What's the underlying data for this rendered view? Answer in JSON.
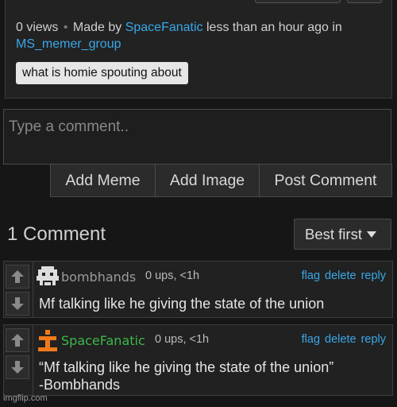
{
  "meme": {
    "views": "0 views",
    "separator": "•",
    "made_by": "Made by",
    "author": "SpaceFanatic",
    "time_in": "less than an hour ago in",
    "group": "MS_memer_group",
    "tag": "what is homie spouting about"
  },
  "composer": {
    "placeholder": "Type a comment..",
    "buttons": [
      "Add Meme",
      "Add Image",
      "Post Comment"
    ]
  },
  "comments_header": {
    "count_label": "1 Comment",
    "sort_label": "Best first"
  },
  "comments": [
    {
      "username": "bombhands",
      "username_color": "#9a9a9a",
      "meta": "0 ups, <1h",
      "actions": [
        "flag",
        "delete",
        "reply"
      ],
      "text_lines": [
        "Mf talking like he giving the state of the union"
      ],
      "avatar_icon": "pixel-face-icon"
    },
    {
      "username": "SpaceFanatic",
      "username_color": "#3bb84a",
      "meta": "0 ups, <1h",
      "actions": [
        "flag",
        "delete",
        "reply"
      ],
      "text_lines": [
        "“Mf talking like he giving the state of the union”",
        "-Bombhands"
      ],
      "avatar_icon": "orange-figure-icon"
    }
  ],
  "footer": {
    "watermark": "imgflip.com"
  },
  "colors": {
    "link": "#38a8e8",
    "background": "#161616"
  }
}
